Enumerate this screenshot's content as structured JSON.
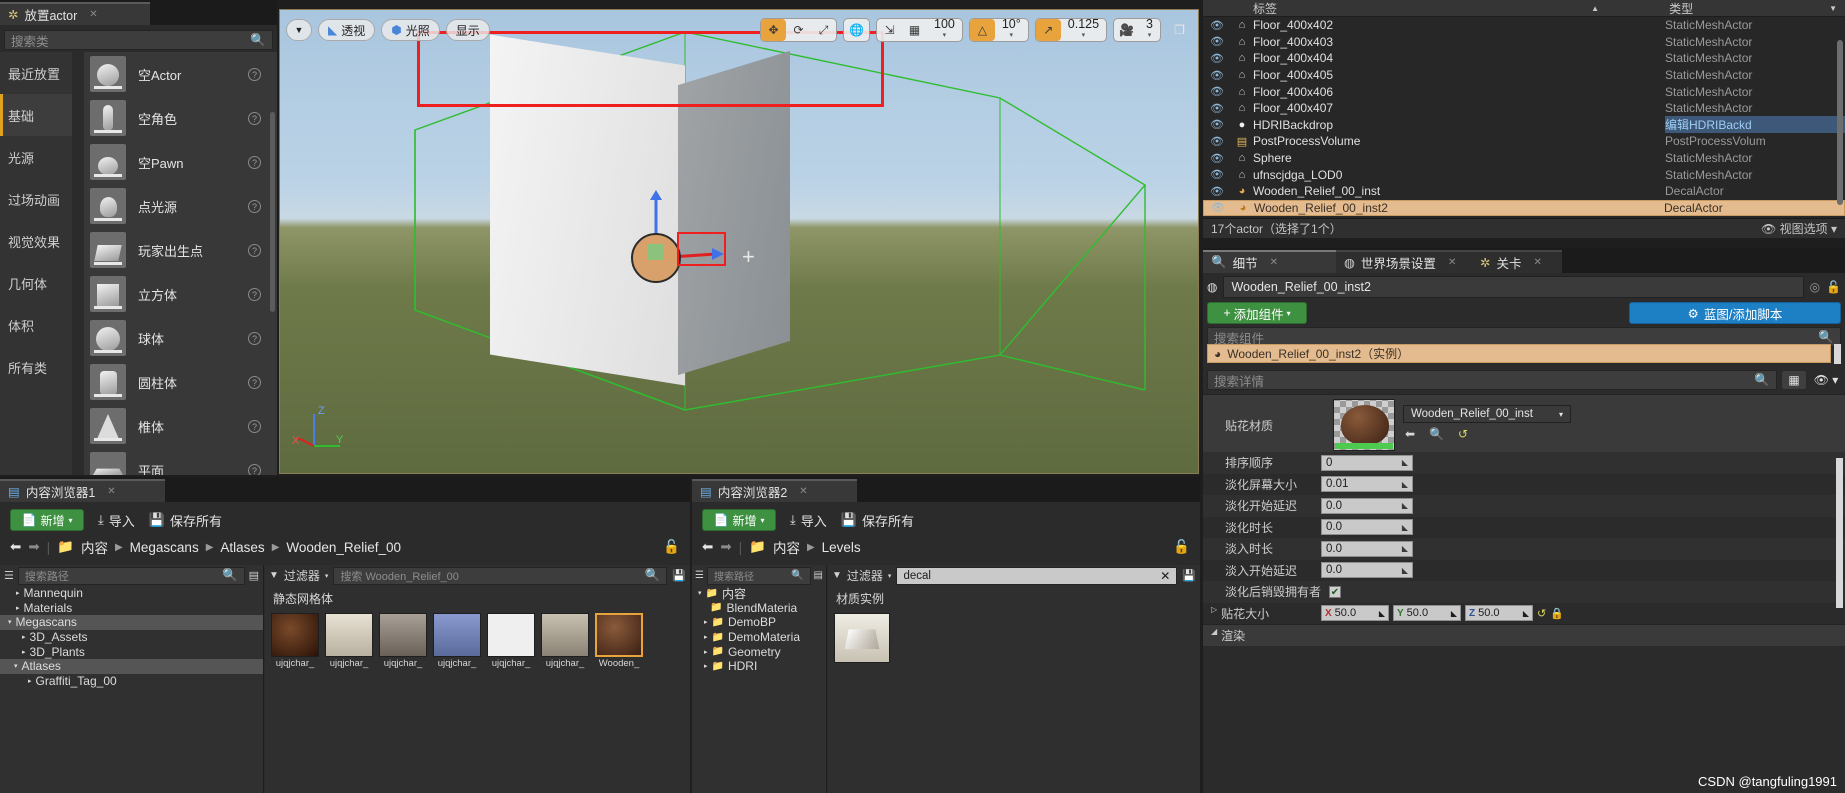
{
  "place_actors": {
    "tab_label": "放置actor",
    "tab_icon": "place-actor-icon",
    "search_placeholder": "搜索类",
    "categories": [
      {
        "label": "最近放置",
        "selected": false
      },
      {
        "label": "基础",
        "selected": true
      },
      {
        "label": "光源",
        "selected": false
      },
      {
        "label": "过场动画",
        "selected": false
      },
      {
        "label": "视觉效果",
        "selected": false
      },
      {
        "label": "几何体",
        "selected": false
      },
      {
        "label": "体积",
        "selected": false
      },
      {
        "label": "所有类",
        "selected": false
      }
    ],
    "items": [
      {
        "label": "空Actor",
        "shape": "sphere"
      },
      {
        "label": "空角色",
        "shape": "character"
      },
      {
        "label": "空Pawn",
        "shape": "pawn"
      },
      {
        "label": "点光源",
        "shape": "bulb"
      },
      {
        "label": "玩家出生点",
        "shape": "flag"
      },
      {
        "label": "立方体",
        "shape": "cube"
      },
      {
        "label": "球体",
        "shape": "sphere"
      },
      {
        "label": "圆柱体",
        "shape": "cylinder"
      },
      {
        "label": "椎体",
        "shape": "cone"
      },
      {
        "label": "平面",
        "shape": "plane"
      }
    ]
  },
  "viewport": {
    "menu_arrow": "▼",
    "perspective_label": "透视",
    "lit_label": "光照",
    "show_label": "显示",
    "transform_modes": [
      {
        "name": "select-move-icon",
        "glyph": "✥",
        "active": true
      },
      {
        "name": "rotate-icon",
        "glyph": "⟳",
        "active": false
      },
      {
        "name": "scale-icon",
        "glyph": "⤢",
        "active": false
      }
    ],
    "world_space_icon": "🌐",
    "surface_snap_icon": "⇲",
    "grid_snap_icon": "▦",
    "grid_snap_value": "100",
    "angle_snap_icon": "△",
    "angle_snap_value": "10°",
    "scale_snap_icon": "↗",
    "scale_snap_value": "0.125",
    "camera_speed_icon": "camera-icon",
    "camera_speed_value": "3",
    "maximize_icon": "❐",
    "axis_x": "X",
    "axis_y": "Y",
    "axis_z": "Z"
  },
  "outliner": {
    "col_label": "标签",
    "col_type": "类型",
    "sort_icon": "▲",
    "filter_icon": "▼",
    "rows": [
      {
        "name": "Floor_400x402",
        "type": "StaticMeshActor",
        "icon": "mesh-icon",
        "selected": false,
        "link": false
      },
      {
        "name": "Floor_400x403",
        "type": "StaticMeshActor",
        "icon": "mesh-icon",
        "selected": false,
        "link": false
      },
      {
        "name": "Floor_400x404",
        "type": "StaticMeshActor",
        "icon": "mesh-icon",
        "selected": false,
        "link": false
      },
      {
        "name": "Floor_400x405",
        "type": "StaticMeshActor",
        "icon": "mesh-icon",
        "selected": false,
        "link": false
      },
      {
        "name": "Floor_400x406",
        "type": "StaticMeshActor",
        "icon": "mesh-icon",
        "selected": false,
        "link": false
      },
      {
        "name": "Floor_400x407",
        "type": "StaticMeshActor",
        "icon": "mesh-icon",
        "selected": false,
        "link": false
      },
      {
        "name": "HDRIBackdrop",
        "type": "编辑HDRIBackd",
        "icon": "sphere-icon",
        "selected": false,
        "link": true
      },
      {
        "name": "PostProcessVolume",
        "type": "PostProcessVolum",
        "icon": "volume-icon",
        "selected": false,
        "link": false
      },
      {
        "name": "Sphere",
        "type": "StaticMeshActor",
        "icon": "mesh-icon",
        "selected": false,
        "link": false
      },
      {
        "name": "ufnscjdga_LOD0",
        "type": "StaticMeshActor",
        "icon": "mesh-icon",
        "selected": false,
        "link": false
      },
      {
        "name": "Wooden_Relief_00_inst",
        "type": "DecalActor",
        "icon": "decal-icon",
        "selected": false,
        "link": false
      },
      {
        "name": "Wooden_Relief_00_inst2",
        "type": "DecalActor",
        "icon": "decal-icon",
        "selected": true,
        "link": false
      }
    ],
    "status": "17个actor（选择了1个）",
    "view_options": "视图选项",
    "view_options_icon": "eye-icon"
  },
  "details": {
    "tabs": [
      {
        "label": "细节",
        "icon": "details-icon",
        "active": true
      },
      {
        "label": "世界场景设置",
        "icon": "world-icon",
        "active": false
      },
      {
        "label": "关卡",
        "icon": "level-icon",
        "active": false
      }
    ],
    "actor_name": "Wooden_Relief_00_inst2",
    "help_icon": "question-icon",
    "lock_icon": "lock-icon",
    "add_component": "添加组件",
    "blueprint_button": "蓝图/添加脚本",
    "blueprint_icon": "gear-icon",
    "search_components_placeholder": "搜索组件",
    "component_row": "Wooden_Relief_00_inst2（实例）",
    "search_details_placeholder": "搜索详情",
    "grid_icon": "grid-icon",
    "eye_icon": "eye-icon",
    "decal_material_label": "贴花材质",
    "decal_material_value": "Wooden_Relief_00_inst",
    "decal_nav_icons": [
      "arrow-left-icon",
      "browse-icon",
      "reset-icon"
    ],
    "properties": [
      {
        "label": "排序顺序",
        "value": "0"
      },
      {
        "label": "淡化屏幕大小",
        "value": "0.01"
      },
      {
        "label": "淡化开始延迟",
        "value": "0.0"
      },
      {
        "label": "淡化时长",
        "value": "0.0"
      },
      {
        "label": "淡入时长",
        "value": "0.0"
      },
      {
        "label": "淡入开始延迟",
        "value": "0.0"
      }
    ],
    "checkbox_label": "淡化后销毁拥有者",
    "checkbox_checked": true,
    "decal_size_label": "贴花大小",
    "decal_size": [
      {
        "axis": "X",
        "value": "50.0"
      },
      {
        "axis": "Y",
        "value": "50.0"
      },
      {
        "axis": "Z",
        "value": "50.0"
      }
    ],
    "render_section": "渲染",
    "expand_icon": "▷"
  },
  "content_browser_1": {
    "tab_label": "内容浏览器1",
    "tab_icon": "content-browser-icon",
    "add_label": "新增",
    "import_label": "导入",
    "save_all_label": "保存所有",
    "back_icon": "arrow-left-icon",
    "forward_icon": "arrow-right-icon",
    "folder_icon": "folder-icon",
    "breadcrumb": [
      "内容",
      "Megascans",
      "Atlases",
      "Wooden_Relief_00"
    ],
    "path_placeholder": "搜索路径",
    "filter_label": "过滤器",
    "asset_search_placeholder": "搜索 Wooden_Relief_00",
    "section_label": "静态网格体",
    "tree": [
      {
        "label": "Mannequin",
        "depth": 1,
        "expand": "▸",
        "selected": false
      },
      {
        "label": "Materials",
        "depth": 1,
        "expand": "▸",
        "selected": false
      },
      {
        "label": "Megascans",
        "depth": 0,
        "expand": "▾",
        "selected": true
      },
      {
        "label": "3D_Assets",
        "depth": 1,
        "expand": "▸",
        "selected": false
      },
      {
        "label": "3D_Plants",
        "depth": 1,
        "expand": "▸",
        "selected": false
      },
      {
        "label": "Atlases",
        "depth": 1,
        "expand": "▾",
        "selected": true
      },
      {
        "label": "Graffiti_Tag_00",
        "depth": 2,
        "expand": "▸",
        "selected": false
      }
    ],
    "assets": [
      {
        "name": "ujqjchar_",
        "selected": false,
        "color": "#4a2c1c"
      },
      {
        "name": "ujqjchar_",
        "selected": false,
        "color": "#c8c2b4"
      },
      {
        "name": "ujqjchar_",
        "selected": false,
        "color": "#9a9186"
      },
      {
        "name": "ujqjchar_",
        "selected": false,
        "color": "#6a7ab0"
      },
      {
        "name": "ujqjchar_",
        "selected": false,
        "color": "#e8e8e8"
      },
      {
        "name": "ujqjchar_",
        "selected": false,
        "color": "#b9b2a4"
      },
      {
        "name": "Wooden_",
        "selected": true,
        "color": "#5a3420"
      }
    ]
  },
  "content_browser_2": {
    "tab_label": "内容浏览器2",
    "tab_icon": "content-browser-icon",
    "add_label": "新增",
    "import_label": "导入",
    "save_all_label": "保存所有",
    "breadcrumb": [
      "内容",
      "Levels"
    ],
    "path_placeholder": "搜索路径",
    "filter_label": "过滤器",
    "asset_search_value": "decal",
    "clear_icon": "close-icon",
    "save_search_icon": "save-icon",
    "section_label": "材质实例",
    "tree": [
      {
        "label": "内容",
        "depth": 0,
        "expand": "▾",
        "folder": true
      },
      {
        "label": "BlendMateria",
        "depth": 1,
        "expand": "",
        "folder": true
      },
      {
        "label": "DemoBP",
        "depth": 1,
        "expand": "▸",
        "folder": true
      },
      {
        "label": "DemoMateria",
        "depth": 1,
        "expand": "▸",
        "folder": true
      },
      {
        "label": "Geometry",
        "depth": 1,
        "expand": "▸",
        "folder": true
      },
      {
        "label": "HDRI",
        "depth": 1,
        "expand": "▸",
        "folder": true
      }
    ],
    "assets": [
      {
        "name": "",
        "selected": false,
        "color": "#d8cfc0"
      }
    ]
  },
  "watermark": "CSDN @tangfuling1991"
}
